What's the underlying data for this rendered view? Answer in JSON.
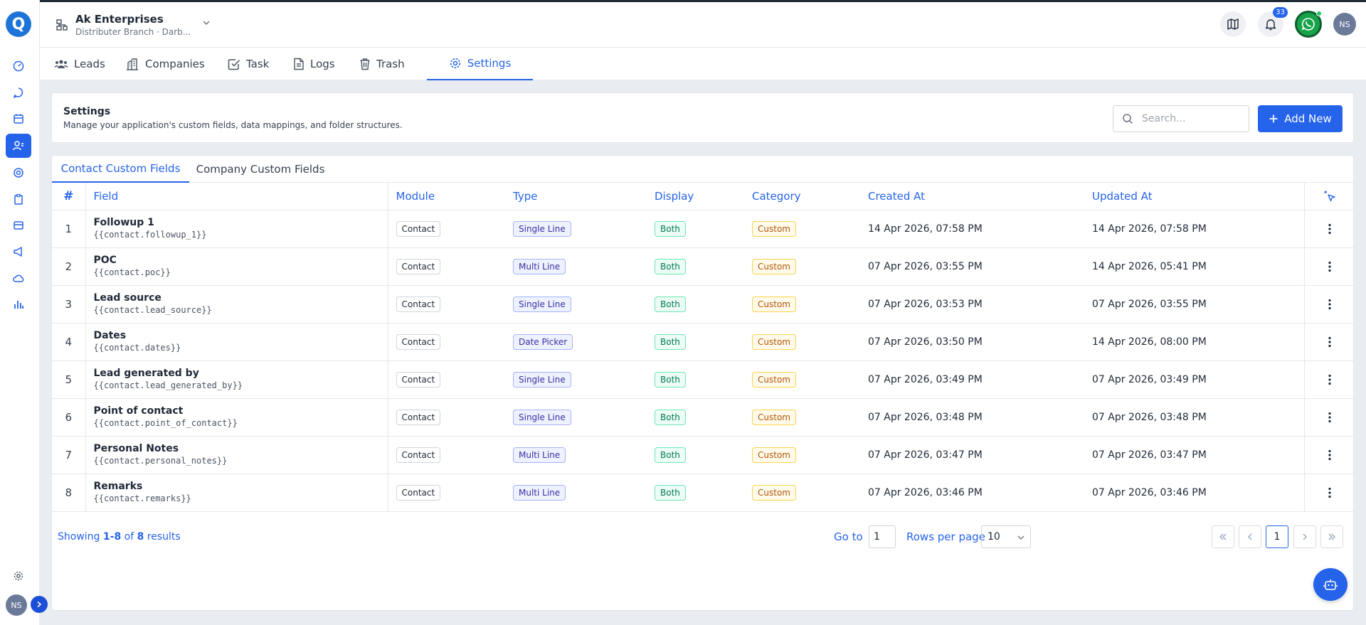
{
  "app": {
    "logo_letter": "Q",
    "brand_color": "#2563eb"
  },
  "rail": {
    "icons": [
      "gauge-icon",
      "chat-icon",
      "calendar-icon",
      "contacts-icon",
      "target-icon",
      "clipboard-icon",
      "card-icon",
      "megaphone-icon",
      "cloud-icon",
      "bar-chart-icon"
    ],
    "active": "contacts-icon",
    "bottom_avatar": "NS"
  },
  "topbar": {
    "org_name": "Ak Enterprises",
    "org_sub": "Distributer Branch · Darb...",
    "notification_count": "33",
    "avatar": "NS"
  },
  "nav": {
    "tabs": [
      {
        "label": "Leads",
        "icon": "users-icon"
      },
      {
        "label": "Companies",
        "icon": "building-icon"
      },
      {
        "label": "Task",
        "icon": "check-square-icon"
      },
      {
        "label": "Logs",
        "icon": "file-icon"
      },
      {
        "label": "Trash",
        "icon": "trash-icon"
      },
      {
        "label": "Settings",
        "icon": "gear-icon"
      }
    ],
    "active": "Settings"
  },
  "settings": {
    "title": "Settings",
    "subtitle": "Manage your application's custom fields, data mappings, and folder structures.",
    "search_placeholder": "Search...",
    "add_button": "Add New"
  },
  "subtabs": [
    "Contact Custom Fields",
    "Company Custom Fields"
  ],
  "table": {
    "headers": {
      "no": "#",
      "field": "Field",
      "module": "Module",
      "type": "Type",
      "display": "Display",
      "category": "Category",
      "created": "Created At",
      "updated": "Updated At"
    },
    "rows": [
      {
        "no": "1",
        "name": "Followup 1",
        "key": "{{contact.followup_1}}",
        "module": "Contact",
        "type": "Single Line",
        "display": "Both",
        "category": "Custom",
        "created": "14 Apr 2026, 07:58 PM",
        "updated": "14 Apr 2026, 07:58 PM"
      },
      {
        "no": "2",
        "name": "POC",
        "key": "{{contact.poc}}",
        "module": "Contact",
        "type": "Multi Line",
        "display": "Both",
        "category": "Custom",
        "created": "07 Apr 2026, 03:55 PM",
        "updated": "14 Apr 2026, 05:41 PM"
      },
      {
        "no": "3",
        "name": "Lead source",
        "key": "{{contact.lead_source}}",
        "module": "Contact",
        "type": "Single Line",
        "display": "Both",
        "category": "Custom",
        "created": "07 Apr 2026, 03:53 PM",
        "updated": "07 Apr 2026, 03:55 PM"
      },
      {
        "no": "4",
        "name": "Dates",
        "key": "{{contact.dates}}",
        "module": "Contact",
        "type": "Date Picker",
        "display": "Both",
        "category": "Custom",
        "created": "07 Apr 2026, 03:50 PM",
        "updated": "14 Apr 2026, 08:00 PM"
      },
      {
        "no": "5",
        "name": "Lead generated by",
        "key": "{{contact.lead_generated_by}}",
        "module": "Contact",
        "type": "Single Line",
        "display": "Both",
        "category": "Custom",
        "created": "07 Apr 2026, 03:49 PM",
        "updated": "07 Apr 2026, 03:49 PM"
      },
      {
        "no": "6",
        "name": "Point of contact",
        "key": "{{contact.point_of_contact}}",
        "module": "Contact",
        "type": "Single Line",
        "display": "Both",
        "category": "Custom",
        "created": "07 Apr 2026, 03:48 PM",
        "updated": "07 Apr 2026, 03:48 PM"
      },
      {
        "no": "7",
        "name": "Personal Notes",
        "key": "{{contact.personal_notes}}",
        "module": "Contact",
        "type": "Multi Line",
        "display": "Both",
        "category": "Custom",
        "created": "07 Apr 2026, 03:47 PM",
        "updated": "07 Apr 2026, 03:47 PM"
      },
      {
        "no": "8",
        "name": "Remarks",
        "key": "{{contact.remarks}}",
        "module": "Contact",
        "type": "Multi Line",
        "display": "Both",
        "category": "Custom",
        "created": "07 Apr 2026, 03:46 PM",
        "updated": "07 Apr 2026, 03:46 PM"
      }
    ]
  },
  "footer": {
    "showing_prefix": "Showing",
    "range": "1-8",
    "of": "of",
    "total": "8",
    "results": "results",
    "goto_label": "Go to",
    "goto_value": "1",
    "rows_label": "Rows per page",
    "rows_value": "10",
    "current_page": "1"
  }
}
